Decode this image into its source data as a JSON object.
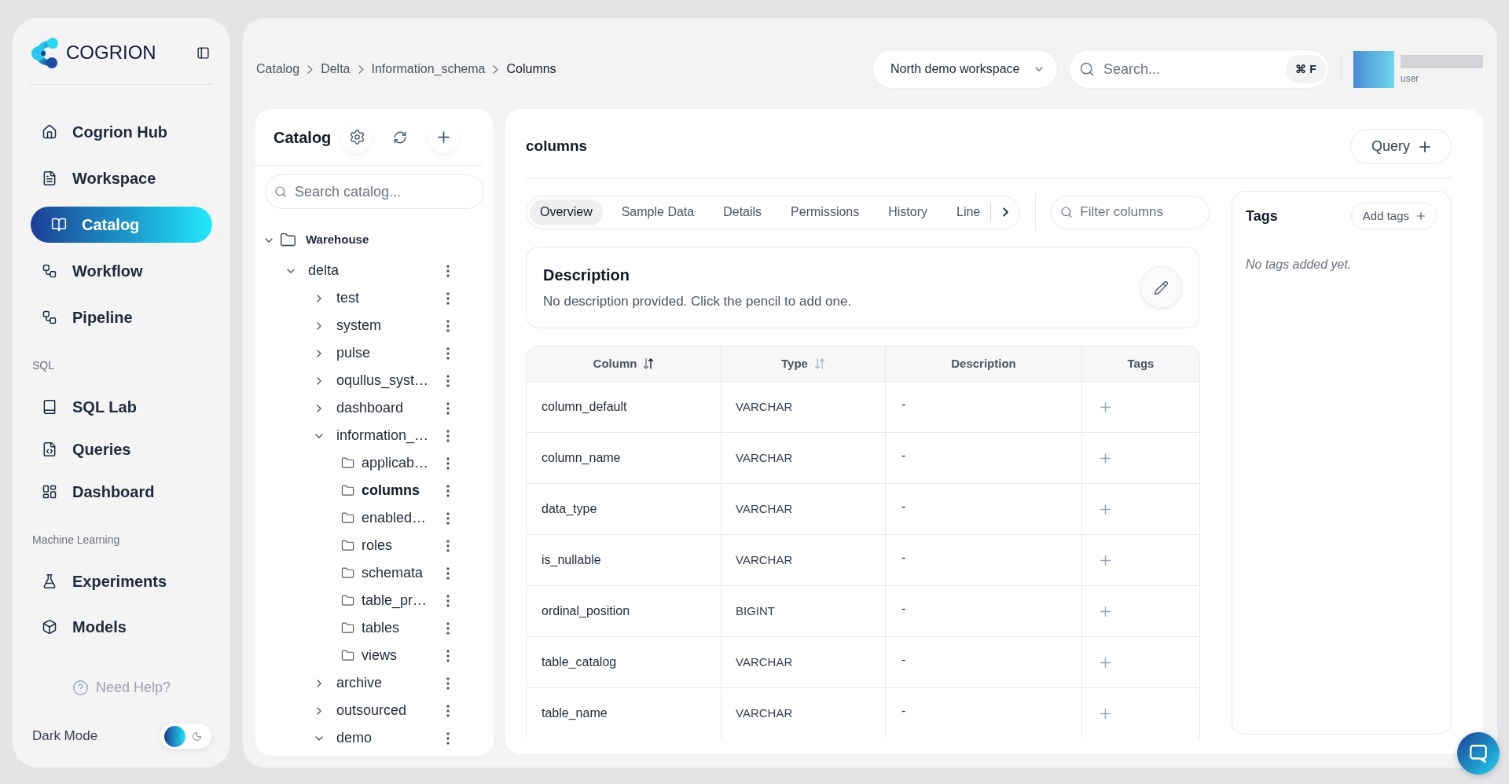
{
  "sidebar": {
    "logo": "COGRION",
    "sections": [
      {
        "items": [
          {
            "label": "Cogrion Hub",
            "selected": false
          },
          {
            "label": "Workspace",
            "selected": false
          },
          {
            "label": "Catalog",
            "selected": true
          },
          {
            "label": "Workflow",
            "selected": false
          },
          {
            "label": "Pipeline",
            "selected": false
          }
        ]
      },
      {
        "title": "SQL",
        "items": [
          {
            "label": "SQL Lab",
            "selected": false
          },
          {
            "label": "Queries",
            "selected": false
          },
          {
            "label": "Dashboard",
            "selected": false
          }
        ]
      },
      {
        "title": "Machine Learning",
        "items": [
          {
            "label": "Experiments",
            "selected": false
          },
          {
            "label": "Models",
            "selected": false
          }
        ]
      }
    ],
    "help": "Need Help?",
    "dark_mode": {
      "label": "Dark Mode",
      "on": false
    }
  },
  "topbar": {
    "breadcrumb": [
      "Catalog",
      "Delta",
      "Information_schema",
      "Columns"
    ],
    "workspace": "North demo workspace",
    "search": {
      "placeholder": "Search...",
      "shortcut": "⌘ F"
    },
    "user": {
      "role": "user"
    }
  },
  "catalog": {
    "title": "Catalog",
    "search": {
      "placeholder": "Search catalog..."
    },
    "tree": [
      {
        "label": "Warehouse",
        "kind": "root",
        "expanded": true,
        "children": [
          {
            "label": "delta",
            "kind": "group",
            "expanded": true,
            "children": [
              {
                "label": "test",
                "kind": "group",
                "expanded": false
              },
              {
                "label": "system",
                "kind": "group",
                "expanded": false
              },
              {
                "label": "pulse",
                "kind": "group",
                "expanded": false
              },
              {
                "label": "oqullus_syst…",
                "kind": "group",
                "expanded": false
              },
              {
                "label": "dashboard",
                "kind": "group",
                "expanded": false
              },
              {
                "label": "information_…",
                "kind": "group",
                "expanded": true,
                "children": [
                  {
                    "label": "applicab…",
                    "kind": "table",
                    "selected": false
                  },
                  {
                    "label": "columns",
                    "kind": "table",
                    "selected": true
                  },
                  {
                    "label": "enabled…",
                    "kind": "table",
                    "selected": false
                  },
                  {
                    "label": "roles",
                    "kind": "table",
                    "selected": false
                  },
                  {
                    "label": "schemata",
                    "kind": "table",
                    "selected": false
                  },
                  {
                    "label": "table_pr…",
                    "kind": "table",
                    "selected": false
                  },
                  {
                    "label": "tables",
                    "kind": "table",
                    "selected": false
                  },
                  {
                    "label": "views",
                    "kind": "table",
                    "selected": false
                  }
                ]
              },
              {
                "label": "archive",
                "kind": "group",
                "expanded": false
              },
              {
                "label": "outsourced",
                "kind": "group",
                "expanded": false
              },
              {
                "label": "demo",
                "kind": "group",
                "expanded": true
              }
            ]
          }
        ]
      }
    ]
  },
  "detail": {
    "title": "columns",
    "query_button": "Query",
    "tabs": [
      {
        "label": "Overview",
        "selected": true
      },
      {
        "label": "Sample Data",
        "selected": false
      },
      {
        "label": "Details",
        "selected": false
      },
      {
        "label": "Permissions",
        "selected": false
      },
      {
        "label": "History",
        "selected": false
      },
      {
        "label": "Line",
        "selected": false
      }
    ],
    "filter": {
      "placeholder": "Filter columns"
    },
    "description": {
      "title": "Description",
      "text": "No description provided. Click the pencil to add one."
    },
    "table": {
      "columns": [
        {
          "label": "Column",
          "sortable": true,
          "sorted": true
        },
        {
          "label": "Type",
          "sortable": true,
          "sorted": false
        },
        {
          "label": "Description",
          "sortable": false
        },
        {
          "label": "Tags",
          "sortable": false
        }
      ],
      "rows": [
        {
          "column": "column_default",
          "type": "VARCHAR",
          "description": "-"
        },
        {
          "column": "column_name",
          "type": "VARCHAR",
          "description": "-"
        },
        {
          "column": "data_type",
          "type": "VARCHAR",
          "description": "-"
        },
        {
          "column": "is_nullable",
          "type": "VARCHAR",
          "description": "-"
        },
        {
          "column": "ordinal_position",
          "type": "BIGINT",
          "description": "-"
        },
        {
          "column": "table_catalog",
          "type": "VARCHAR",
          "description": "-"
        },
        {
          "column": "table_name",
          "type": "VARCHAR",
          "description": "-"
        }
      ]
    },
    "tags": {
      "title": "Tags",
      "add_button": "Add tags",
      "empty": "No tags added yet."
    }
  }
}
